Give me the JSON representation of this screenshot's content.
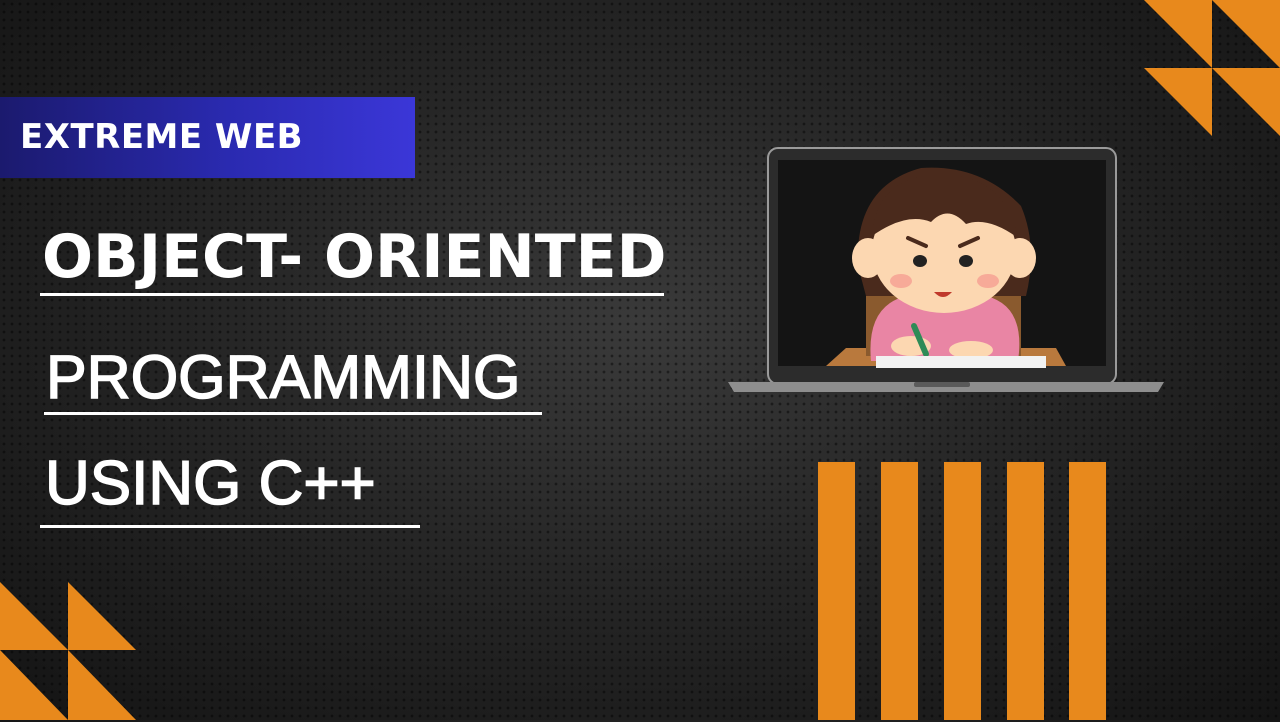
{
  "brand": {
    "label": "EXTREME WEB"
  },
  "title": {
    "line1": "OBJECT- ORIENTED",
    "line2": "PROGRAMMING",
    "line3": "USING  C++"
  },
  "colors": {
    "accent_orange": "#e8891c",
    "brand_blue": "#2a2ab0",
    "background": "#1f1f1f"
  },
  "illustration": {
    "icon": "laptop-with-studying-girl-icon"
  }
}
